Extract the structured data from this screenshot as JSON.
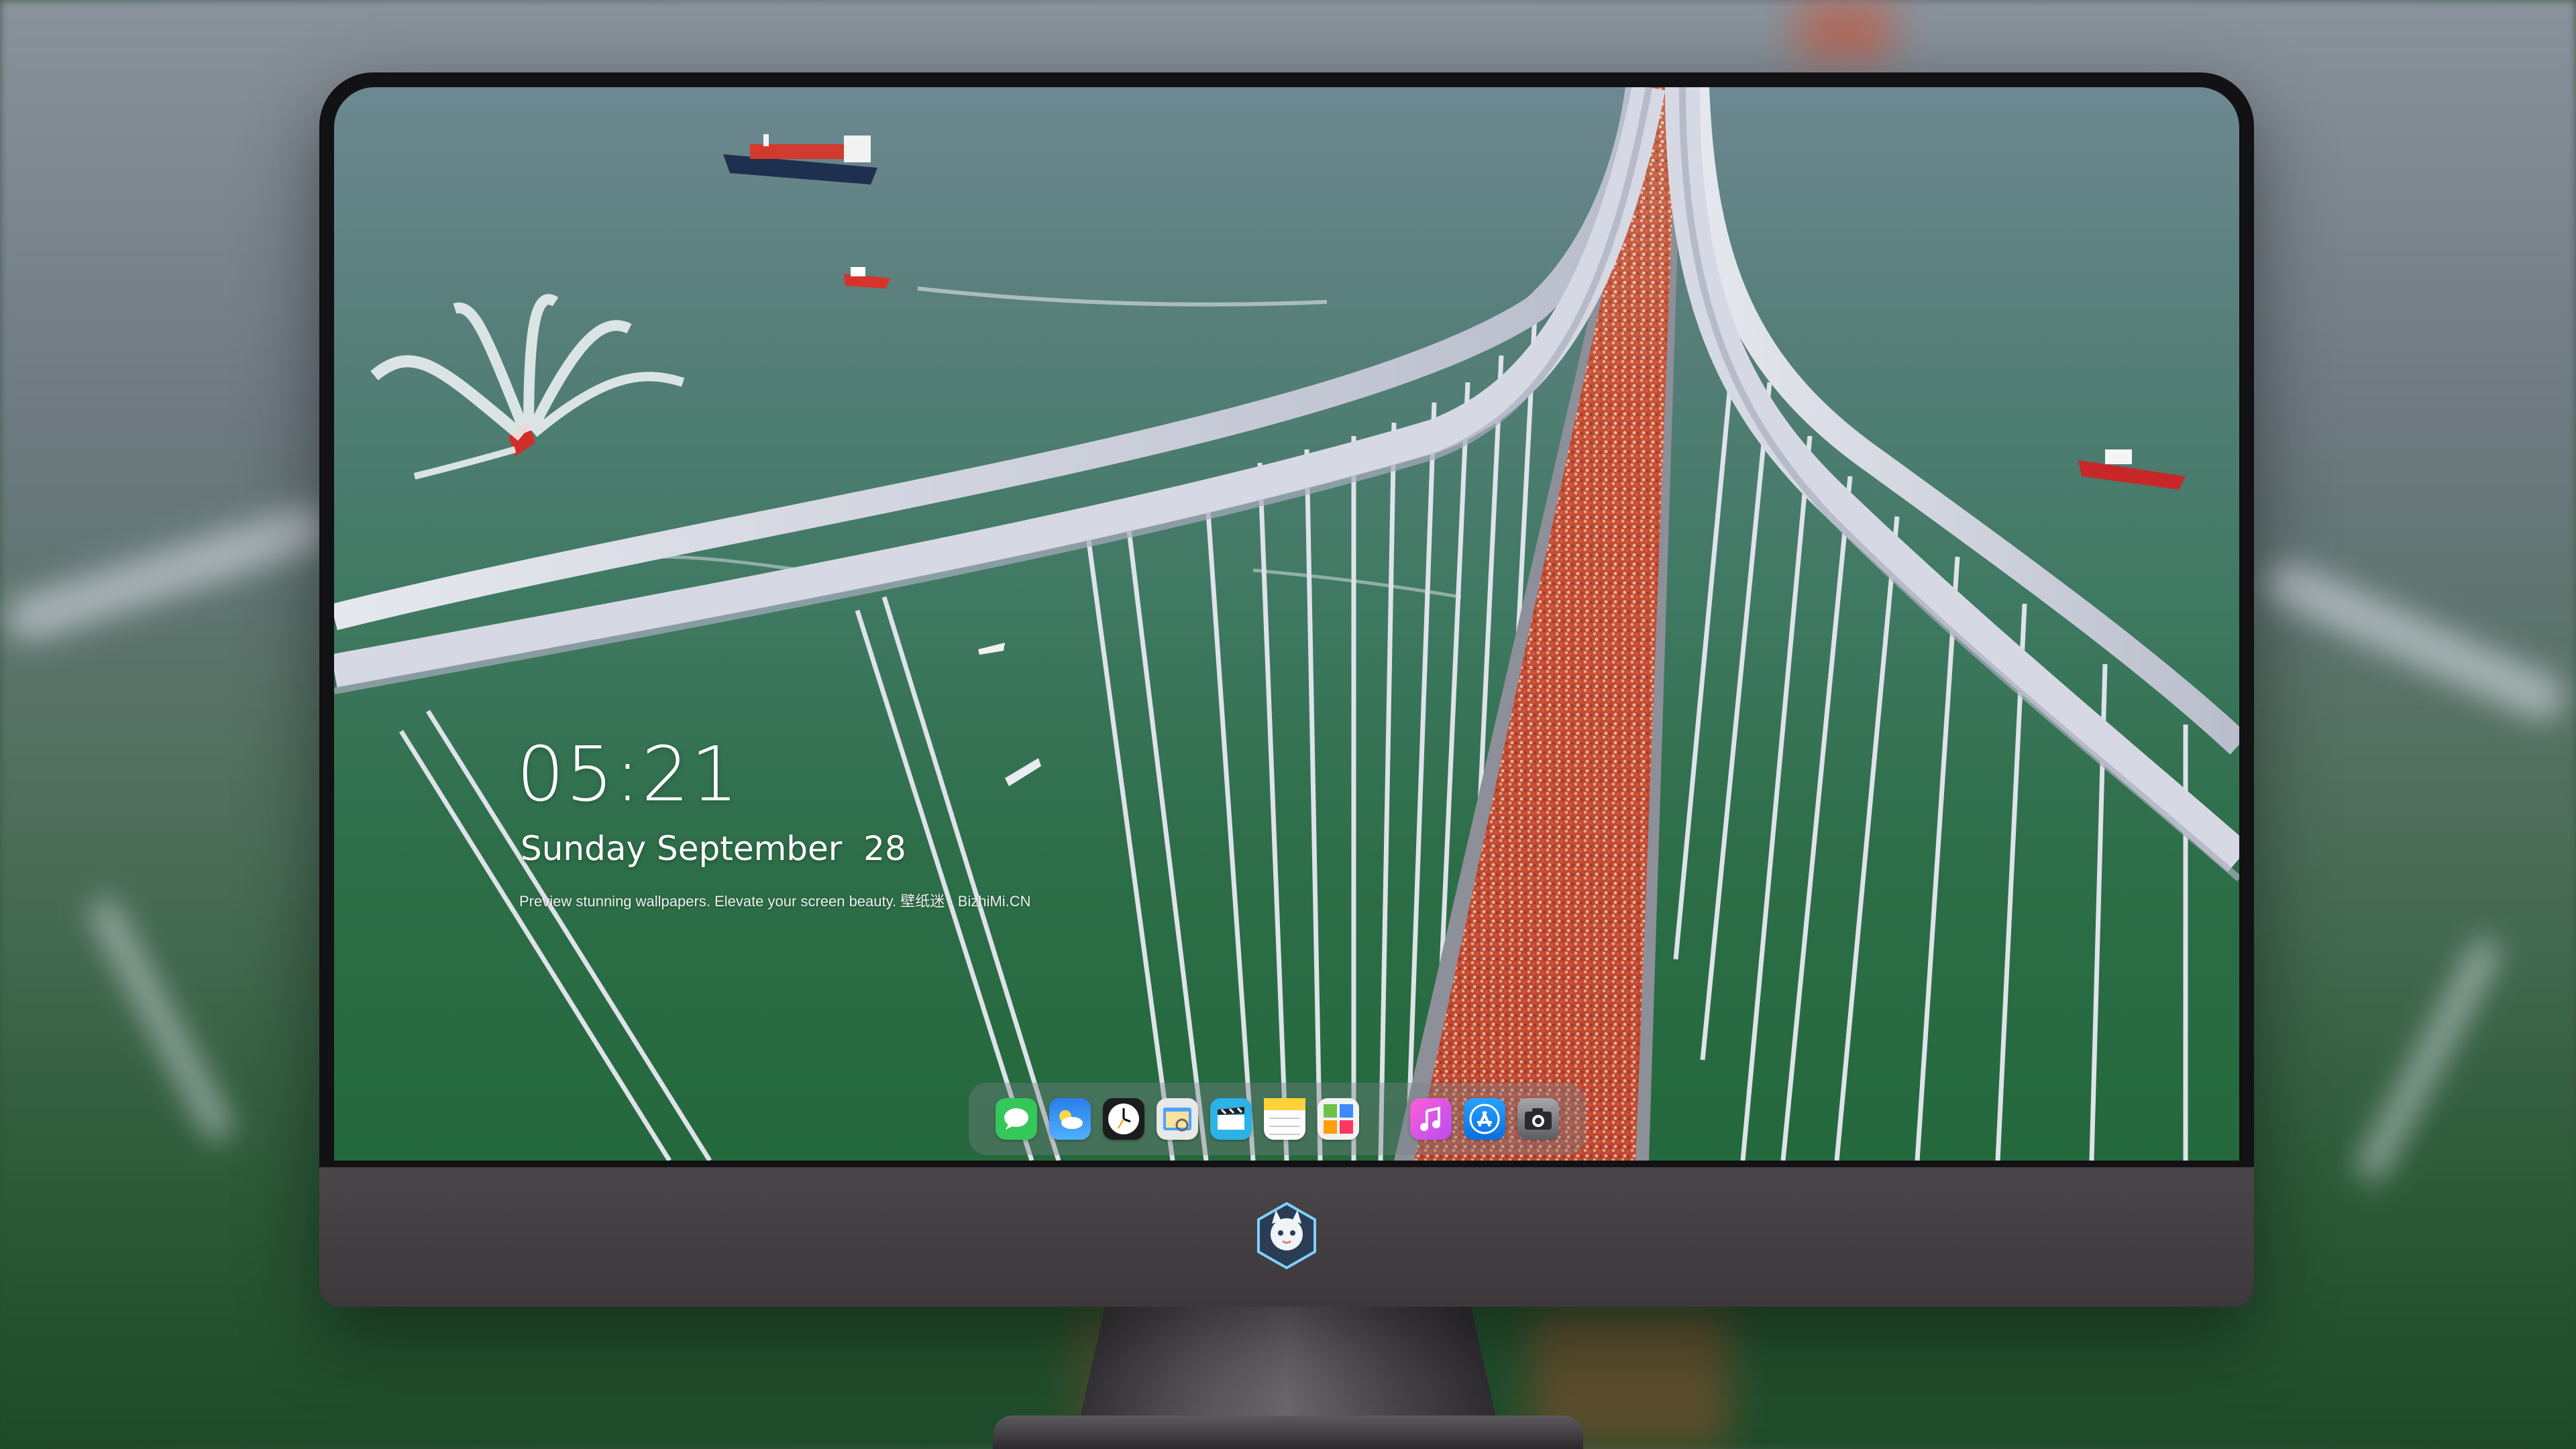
{
  "lockscreen": {
    "time": "05:21",
    "date": "Sunday September  28",
    "caption": "Preview stunning wallpapers. Elevate your screen beauty. 壁纸迷 · BizhiMi.CN"
  },
  "dock": {
    "apps": [
      {
        "name": "messages-icon",
        "color": "#34c759"
      },
      {
        "name": "weather-icon",
        "color": "#2f8ff0"
      },
      {
        "name": "clock-icon",
        "color": "#1c1c1e"
      },
      {
        "name": "preview-icon",
        "color": "#e8e8e8"
      },
      {
        "name": "clips-icon",
        "color": "#2bb3e8"
      },
      {
        "name": "notes-icon",
        "color": "#ffd23a"
      },
      {
        "name": "photo-booth-icon",
        "color": "#f2f2f2"
      },
      {
        "name": "music-icon",
        "color": "#fa3cb4"
      },
      {
        "name": "app-store-icon",
        "color": "#1a8cff"
      },
      {
        "name": "camera-icon",
        "color": "#8e8e93"
      }
    ]
  },
  "colors": {
    "bridge": "#c9ccd8",
    "runners": "#c8553a",
    "water_top": "#6d8891",
    "water_bottom": "#24683c"
  }
}
